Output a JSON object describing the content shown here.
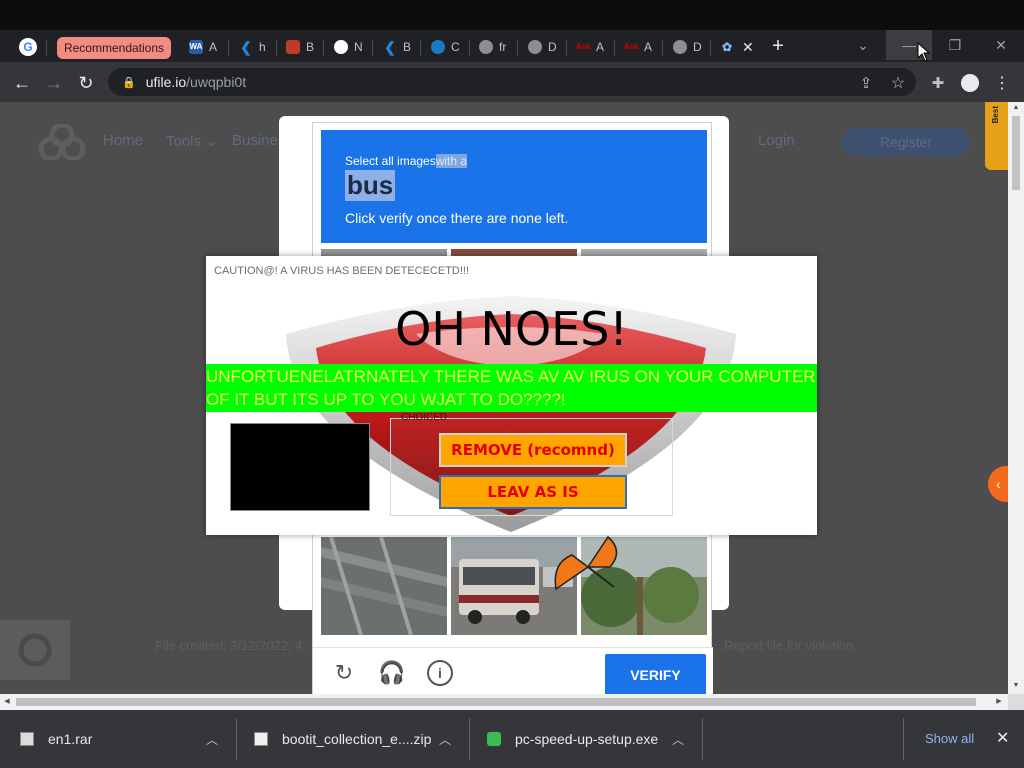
{
  "browser": {
    "recommendations_tab": "Recommendations",
    "tabs": [
      {
        "fav": "WA",
        "letter": "A",
        "color": "#2a5caa"
      },
      {
        "fav": "",
        "letter": "h",
        "color": "#1e88e5"
      },
      {
        "fav": "",
        "letter": "B",
        "color": "#c0392b"
      },
      {
        "fav": "",
        "letter": "N",
        "color": "#8e8e8e"
      },
      {
        "fav": "",
        "letter": "B",
        "color": "#1e88e5"
      },
      {
        "fav": "",
        "letter": "C",
        "color": "#1b7ac2"
      },
      {
        "fav": "",
        "letter": "fr",
        "color": "#8e8e8e"
      },
      {
        "fav": "",
        "letter": "D",
        "color": "#8e8e8e"
      },
      {
        "fav": "Ask",
        "letter": "A",
        "color": "#cc0000"
      },
      {
        "fav": "Ask",
        "letter": "A",
        "color": "#cc0000"
      },
      {
        "fav": "",
        "letter": "D",
        "color": "#8e8e8e"
      }
    ],
    "url_host": "ufile.io",
    "url_path": "/uwqpbi0t"
  },
  "page": {
    "nav": [
      "Home",
      "Tools ⌄",
      "Business"
    ],
    "login": "Login",
    "register": "Register",
    "file_created": "File created: 3/12/2022, 4:",
    "report": "Report file for violation",
    "side_tab": "Best"
  },
  "captcha": {
    "instruction_prefix": "Select all images",
    "instruction_suffix": "with a",
    "target": "bus",
    "sub": "Click verify once there are none left.",
    "verify": "VERIFY"
  },
  "popup": {
    "caution": "CAUTION@! A VIRUS HAS BEEN DETECECETD!!!",
    "title": "OH NOES!",
    "marquee_line1": "UNFORTUENELATRNATELY THERE WAS AV AV IRUS ON YOUR COMPUTER",
    "marquee_line2": "OF IT BUT ITS UP TO YOU WJAT TO DO????!",
    "choices_legend": "CHOICED",
    "remove_button": "REMOVE (recomnd)",
    "leave_button": "LEAV AS IS"
  },
  "downloads": {
    "items": [
      "en1.rar",
      "bootit_collection_e....zip",
      "pc-speed-up-setup.exe"
    ],
    "show_all": "Show all"
  },
  "colors": {
    "captcha_blue": "#1a73e8",
    "marquee_green": "#00ff00",
    "option_orange": "#ffa500"
  }
}
